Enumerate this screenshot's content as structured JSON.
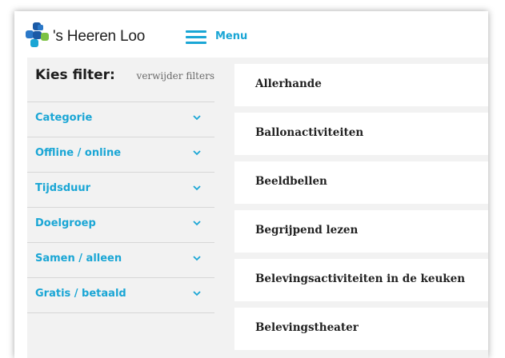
{
  "header": {
    "brand": "'s Heeren Loo",
    "menu_label": "Menu",
    "logo_icon": "puzzle-flower-logo",
    "menu_icon": "hamburger-icon"
  },
  "sidebar": {
    "title": "Kies filter:",
    "clear_label": "verwijder filters",
    "filters": [
      {
        "label": "Categorie"
      },
      {
        "label": "Offline / online"
      },
      {
        "label": "Tijdsduur"
      },
      {
        "label": "Doelgroep"
      },
      {
        "label": "Samen / alleen"
      },
      {
        "label": "Gratis / betaald"
      }
    ]
  },
  "main": {
    "items": [
      {
        "label": "Allerhande"
      },
      {
        "label": "Ballonactiviteiten"
      },
      {
        "label": "Beeldbellen"
      },
      {
        "label": "Begrijpend lezen"
      },
      {
        "label": "Belevingsactiviteiten in de keuken"
      },
      {
        "label": "Belevingstheater"
      }
    ]
  },
  "colors": {
    "accent": "#1aa6d5",
    "logo_blue": "#1b5aa6",
    "logo_green": "#7cc243",
    "panel_bg": "#f2f2f2"
  }
}
